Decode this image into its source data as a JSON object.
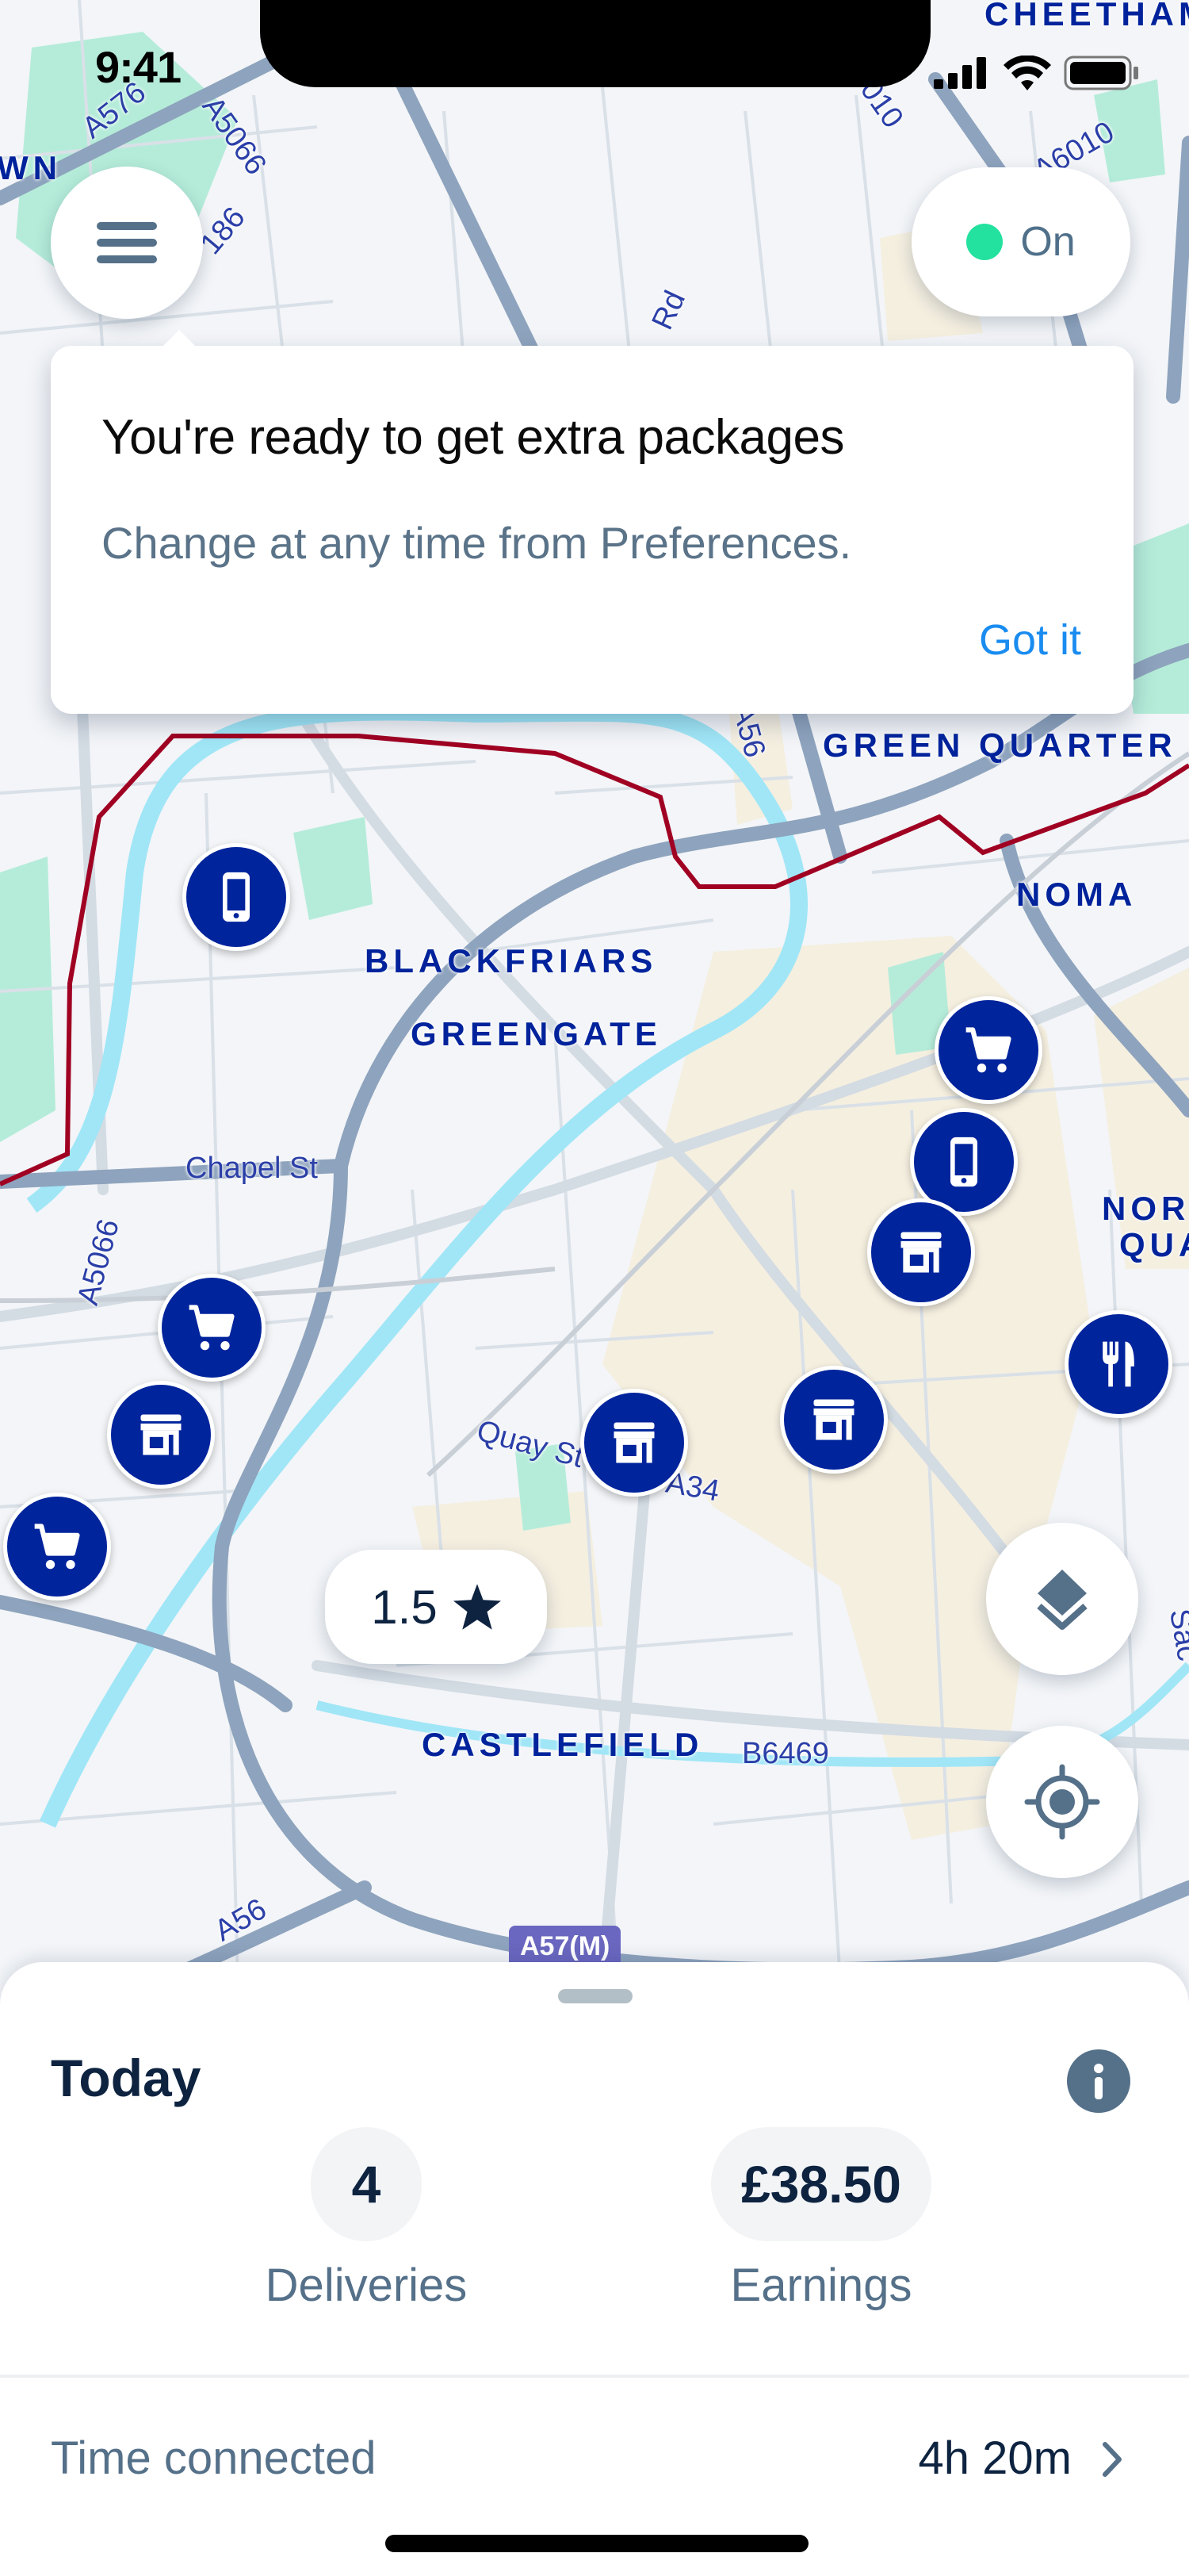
{
  "status_bar": {
    "time": "9:41"
  },
  "colors": {
    "brand_marker": "#00249c",
    "online": "#23e19f",
    "link": "#1a8cf0",
    "zone_border": "#a00022",
    "river": "#a0e6f7",
    "park": "#b5ecd9",
    "major_road": "#8ea3bd",
    "urban": "#f5efe0"
  },
  "top_controls": {
    "menu_label": "menu",
    "online_toggle": {
      "label": "On",
      "state": "on"
    }
  },
  "popup": {
    "title": "You're ready to get extra packages",
    "subtitle": "Change at any time from Preferences.",
    "action": "Got it"
  },
  "map": {
    "area_labels": [
      "GREEN QUARTER",
      "NOMA",
      "BLACKFRIARS",
      "GREENGATE",
      "CASTLEFIELD",
      "CHEETHAM",
      "WN",
      "NOR",
      "QUA"
    ],
    "road_labels": [
      "A576",
      "A5066",
      "186",
      "A6010",
      "A5066",
      "Chapel St",
      "Quay St",
      "A34",
      "B6469",
      "A56",
      "A56",
      "Rd",
      "Sac",
      "010"
    ],
    "road_shield": "A57(M)",
    "markers": [
      {
        "type": "phone"
      },
      {
        "type": "cart"
      },
      {
        "type": "phone"
      },
      {
        "type": "store"
      },
      {
        "type": "food"
      },
      {
        "type": "cart"
      },
      {
        "type": "store"
      },
      {
        "type": "cart"
      },
      {
        "type": "store"
      },
      {
        "type": "store"
      }
    ],
    "rating": {
      "value": "1.5",
      "icon": "star-icon"
    }
  },
  "sheet": {
    "title": "Today",
    "stats": [
      {
        "value": "4",
        "label": "Deliveries"
      },
      {
        "value": "£38.50",
        "label": "Earnings"
      }
    ],
    "time_connected": {
      "label": "Time connected",
      "value": "4h 20m"
    }
  }
}
